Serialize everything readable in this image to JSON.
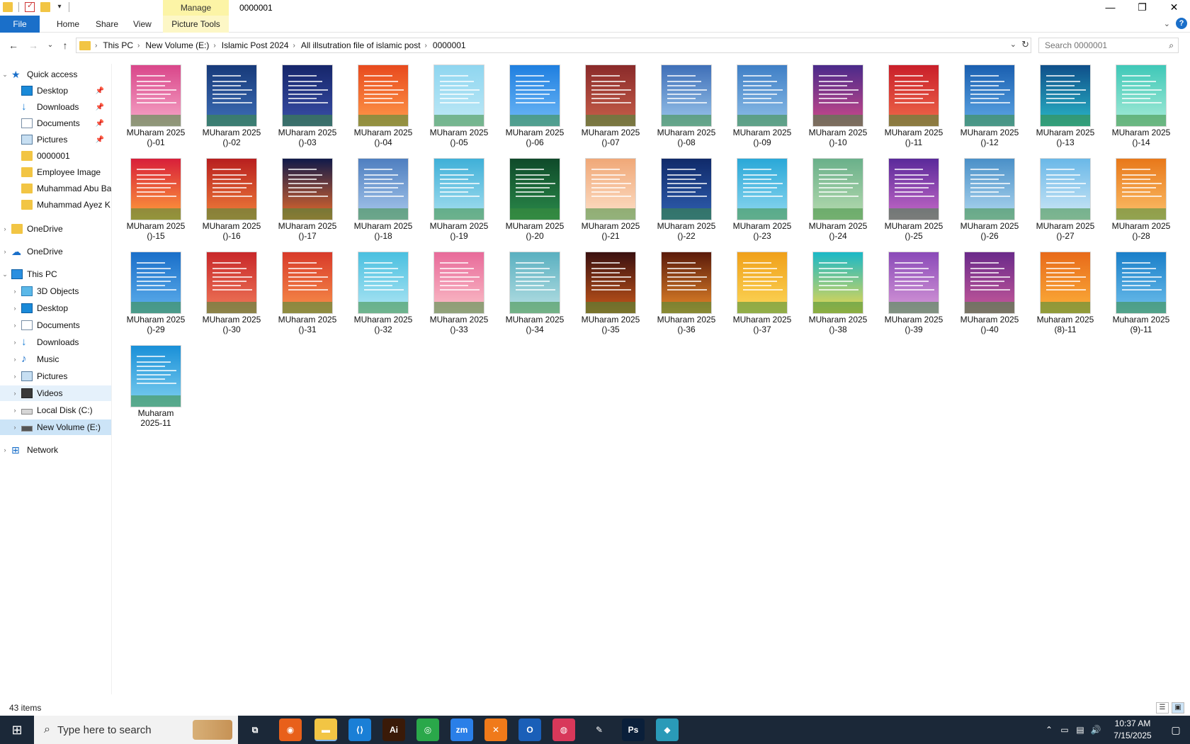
{
  "window": {
    "title": "0000001",
    "manage_tab": "Manage",
    "controls": {
      "minimize": "—",
      "maximize": "❐",
      "close": "✕"
    }
  },
  "ribbon": {
    "tabs": [
      "File",
      "Home",
      "Share",
      "View",
      "Picture Tools"
    ],
    "help": "?"
  },
  "address": {
    "crumbs": [
      "This PC",
      "New Volume (E:)",
      "Islamic Post 2024",
      "All illsutration file of islamic post",
      "0000001"
    ],
    "search_placeholder": "Search 0000001"
  },
  "sidebar": {
    "quick_access": "Quick access",
    "quick_items": [
      "Desktop",
      "Downloads",
      "Documents",
      "Pictures",
      "0000001",
      "Employee Image",
      "Muhammad Abu Ba",
      "Muhammad Ayez K"
    ],
    "onedrive_1": "OneDrive",
    "onedrive_2": "OneDrive",
    "this_pc": "This PC",
    "pc_items": [
      "3D Objects",
      "Desktop",
      "Documents",
      "Downloads",
      "Music",
      "Pictures",
      "Videos",
      "Local Disk (C:)",
      "New Volume (E:)"
    ],
    "network": "Network"
  },
  "files": [
    {
      "l1": "MUharam 2025",
      "l2": "()-01",
      "c": [
        "#d9468a",
        "#f7a8c8"
      ]
    },
    {
      "l1": "MUharam 2025",
      "l2": "()-02",
      "c": [
        "#173a7a",
        "#3e6fb8"
      ]
    },
    {
      "l1": "MUharam 2025",
      "l2": "()-03",
      "c": [
        "#16266b",
        "#3a4fa8"
      ]
    },
    {
      "l1": "MUharam 2025",
      "l2": "()-04",
      "c": [
        "#e84a1e",
        "#ff9a4a"
      ]
    },
    {
      "l1": "MUharam 2025",
      "l2": "()-05",
      "c": [
        "#8fd6f0",
        "#bfe9f6"
      ]
    },
    {
      "l1": "MUharam 2025",
      "l2": "()-06",
      "c": [
        "#1f7fe0",
        "#6fb9f7"
      ]
    },
    {
      "l1": "MUharam 2025",
      "l2": "()-07",
      "c": [
        "#8a2a2a",
        "#c9604a"
      ]
    },
    {
      "l1": "MUharam 2025",
      "l2": "()-08",
      "c": [
        "#3f6fb8",
        "#9cc7ec"
      ]
    },
    {
      "l1": "MUharam 2025",
      "l2": "()-09",
      "c": [
        "#3f7fc6",
        "#8fbfe8"
      ]
    },
    {
      "l1": "MUharam 2025",
      "l2": "()-10",
      "c": [
        "#4a2a8a",
        "#d04a8a"
      ]
    },
    {
      "l1": "MUharam 2025",
      "l2": "()-11",
      "c": [
        "#c91f2a",
        "#f06a4a"
      ]
    },
    {
      "l1": "MUharam 2025",
      "l2": "()-12",
      "c": [
        "#1a5fb0",
        "#5fa8e6"
      ]
    },
    {
      "l1": "MUharam 2025",
      "l2": "()-13",
      "c": [
        "#0f4f8a",
        "#2ab8c8"
      ]
    },
    {
      "l1": "MUharam 2025",
      "l2": "()-14",
      "c": [
        "#3fc8b8",
        "#a8ecd8"
      ]
    },
    {
      "l1": "MUharam 2025",
      "l2": "()-15",
      "c": [
        "#d81f3a",
        "#ffa03a"
      ]
    },
    {
      "l1": "MUharam 2025",
      "l2": "()-16",
      "c": [
        "#b81f1f",
        "#f0803a"
      ]
    },
    {
      "l1": "MUharam 2025",
      "l2": "()-17",
      "c": [
        "#101a4a",
        "#e86a2a"
      ]
    },
    {
      "l1": "MUharam 2025",
      "l2": "()-18",
      "c": [
        "#4f7fc0",
        "#a8c8ec"
      ]
    },
    {
      "l1": "MUharam 2025",
      "l2": "()-19",
      "c": [
        "#3fb0d8",
        "#a8e0f0"
      ]
    },
    {
      "l1": "MUharam 2025",
      "l2": "()-20",
      "c": [
        "#0f4a2a",
        "#2a8a4a"
      ]
    },
    {
      "l1": "MUharam 2025",
      "l2": "()-21",
      "c": [
        "#f0a878",
        "#fde0c8"
      ]
    },
    {
      "l1": "MUharam 2025",
      "l2": "()-22",
      "c": [
        "#102a6a",
        "#2f5fb0"
      ]
    },
    {
      "l1": "MUharam 2025",
      "l2": "()-23",
      "c": [
        "#2aa8d8",
        "#8fd8f0"
      ]
    },
    {
      "l1": "MUharam 2025",
      "l2": "()-24",
      "c": [
        "#6ab08a",
        "#b8dcb0"
      ]
    },
    {
      "l1": "MUharam 2025",
      "l2": "()-25",
      "c": [
        "#5a2a9a",
        "#c86ac8"
      ]
    },
    {
      "l1": "MUharam 2025",
      "l2": "()-26",
      "c": [
        "#4a90c8",
        "#b0d8f0"
      ]
    },
    {
      "l1": "MUharam 2025",
      "l2": "()-27",
      "c": [
        "#6ab8e8",
        "#cfe8f6"
      ]
    },
    {
      "l1": "MUharam 2025",
      "l2": "()-28",
      "c": [
        "#e8781a",
        "#fcc06a"
      ]
    },
    {
      "l1": "MUharam 2025",
      "l2": "()-29",
      "c": [
        "#1a6fc9",
        "#5fb0ec"
      ]
    },
    {
      "l1": "MUharam 2025",
      "l2": "()-30",
      "c": [
        "#c8282a",
        "#f07a5a"
      ]
    },
    {
      "l1": "MUharam 2025",
      "l2": "()-31",
      "c": [
        "#d83a2a",
        "#f8904a"
      ]
    },
    {
      "l1": "MUharam 2025",
      "l2": "()-32",
      "c": [
        "#4ac0e0",
        "#b0e6f4"
      ]
    },
    {
      "l1": "MUharam 2025",
      "l2": "()-33",
      "c": [
        "#e86a9a",
        "#fbc0c8"
      ]
    },
    {
      "l1": "MUharam 2025",
      "l2": "()-34",
      "c": [
        "#5ab0c0",
        "#b8e0e4"
      ]
    },
    {
      "l1": "MUharam 2025",
      "l2": "()-35",
      "c": [
        "#3a1010",
        "#c8581a"
      ]
    },
    {
      "l1": "MUharam 2025",
      "l2": "()-36",
      "c": [
        "#5a1a0a",
        "#e8882a"
      ]
    },
    {
      "l1": "MUharam 2025",
      "l2": "()-37",
      "c": [
        "#f0a01a",
        "#fcd85a"
      ]
    },
    {
      "l1": "MUharam 2025",
      "l2": "()-38",
      "c": [
        "#1ab8c8",
        "#f0d84a"
      ]
    },
    {
      "l1": "MUharam 2025",
      "l2": "()-39",
      "c": [
        "#8a4ab8",
        "#d89ad8"
      ]
    },
    {
      "l1": "MUharam 2025",
      "l2": "()-40",
      "c": [
        "#6a2a8a",
        "#c85a9a"
      ]
    },
    {
      "l1": "Muharam 2025",
      "l2": "(8)-11",
      "c": [
        "#e86a1a",
        "#fcb03a"
      ]
    },
    {
      "l1": "Muharam 2025",
      "l2": "(9)-11",
      "c": [
        "#1a7fc9",
        "#6fc0ec"
      ]
    },
    {
      "l1": "Muharam",
      "l2": "2025-11",
      "c": [
        "#1a90d8",
        "#7fd0f0"
      ]
    }
  ],
  "status": {
    "items": "43 items"
  },
  "taskbar": {
    "search_placeholder": "Type here to search",
    "apps": [
      {
        "name": "taskview",
        "label": "⧉",
        "bg": "transparent"
      },
      {
        "name": "firefox",
        "label": "◉",
        "bg": "#e8601a"
      },
      {
        "name": "explorer",
        "label": "▬",
        "bg": "#f2c544"
      },
      {
        "name": "vscode",
        "label": "⟨⟩",
        "bg": "#1a7fd6"
      },
      {
        "name": "illustrator",
        "label": "Ai",
        "bg": "#3a1a08"
      },
      {
        "name": "chrome",
        "label": "◎",
        "bg": "#2aa84a"
      },
      {
        "name": "zoom",
        "label": "zm",
        "bg": "#2a7fe8"
      },
      {
        "name": "xampp",
        "label": "✕",
        "bg": "#f07a1a"
      },
      {
        "name": "outlook",
        "label": "O",
        "bg": "#1a5fb8"
      },
      {
        "name": "creative-cloud",
        "label": "◍",
        "bg": "#d8385a"
      },
      {
        "name": "pen-tool",
        "label": "✎",
        "bg": "transparent"
      },
      {
        "name": "photoshop",
        "label": "Ps",
        "bg": "#0a1f3a"
      },
      {
        "name": "app-diamond",
        "label": "◆",
        "bg": "#2a9ab8"
      }
    ],
    "time": "10:37 AM",
    "date": "7/15/2025"
  }
}
